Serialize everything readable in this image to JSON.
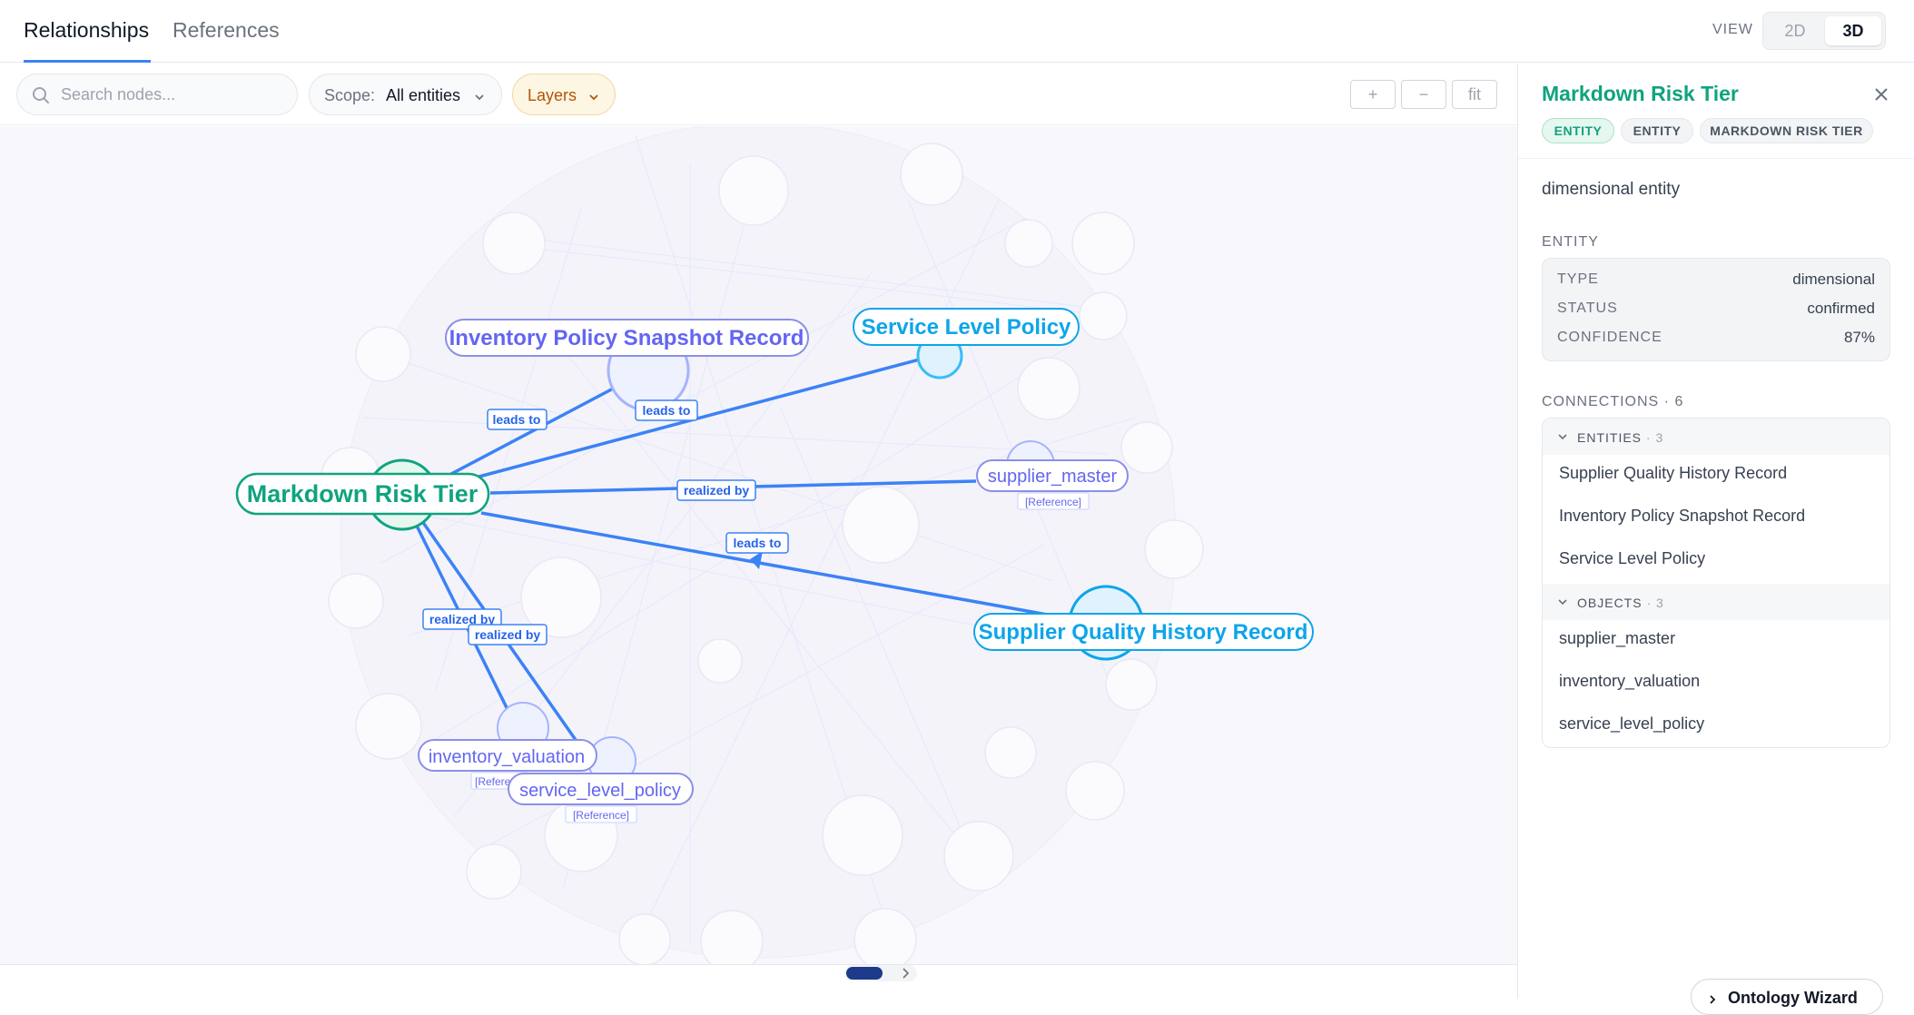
{
  "tabs": [
    {
      "label": "Relationships",
      "active": true
    },
    {
      "label": "References",
      "active": false
    }
  ],
  "view": {
    "label": "VIEW",
    "options": [
      "2D",
      "3D"
    ],
    "selected": "3D"
  },
  "toolbar": {
    "search_placeholder": "Search nodes...",
    "scope_label": "Scope:",
    "scope_value": "All entities",
    "layers_label": "Layers",
    "zoom_in": "+",
    "zoom_out": "−",
    "fit": "fit"
  },
  "graph": {
    "nodes": {
      "markdown": "Markdown Risk Tier",
      "inventory_policy": "Inventory Policy Snapshot Record",
      "service_level": "Service Level Policy",
      "supplier_master": "supplier_master",
      "supplier_quality": "Supplier Quality History Record",
      "inventory_valuation": "inventory_valuation",
      "service_level_policy": "service_level_policy"
    },
    "reference_tags": {
      "supplier_master": "[Reference]",
      "inventory_valuation": "[Refere",
      "service_level_policy": "[Reference]"
    },
    "edge_labels": {
      "leads_to_1": "leads to",
      "leads_to_2": "leads to",
      "leads_to_3": "leads to",
      "realized_by_1": "realized by",
      "realized_by_2": "realized by",
      "realized_by_3": "realized by"
    },
    "colors": {
      "entity": "#10a37f",
      "accent": "#3b82f6",
      "object": "#6366f1",
      "sky": "#0ea5e9"
    }
  },
  "panel": {
    "title": "Markdown Risk Tier",
    "badges": [
      "ENTITY",
      "ENTITY",
      "MARKDOWN RISK TIER"
    ],
    "description": "dimensional entity",
    "entity_section": "ENTITY",
    "properties": [
      {
        "key": "TYPE",
        "value": "dimensional"
      },
      {
        "key": "STATUS",
        "value": "confirmed"
      },
      {
        "key": "CONFIDENCE",
        "value": "87%"
      }
    ],
    "connections_label": "CONNECTIONS · 6",
    "groups": [
      {
        "label": "ENTITIES",
        "count": "· 3",
        "items": [
          "Supplier Quality History Record",
          "Inventory Policy Snapshot Record",
          "Service Level Policy"
        ]
      },
      {
        "label": "OBJECTS",
        "count": "· 3",
        "items": [
          "supplier_master",
          "inventory_valuation",
          "service_level_policy"
        ]
      }
    ]
  },
  "wizard_label": "Ontology Wizard"
}
